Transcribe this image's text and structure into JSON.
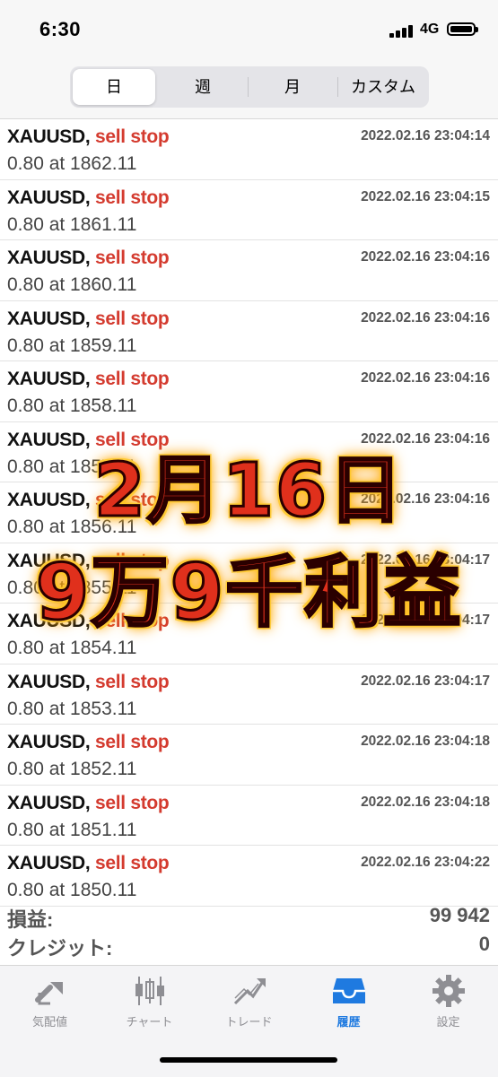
{
  "status_bar": {
    "time": "6:30",
    "network": "4G"
  },
  "segments": {
    "items": [
      "日",
      "週",
      "月",
      "カスタム"
    ],
    "selected": "日"
  },
  "orders": [
    {
      "symbol": "XAUUSD,",
      "type": "sell stop",
      "time": "2022.02.16 23:04:14",
      "volume_price": "0.80 at 1862.11"
    },
    {
      "symbol": "XAUUSD,",
      "type": "sell stop",
      "time": "2022.02.16 23:04:15",
      "volume_price": "0.80 at 1861.11"
    },
    {
      "symbol": "XAUUSD,",
      "type": "sell stop",
      "time": "2022.02.16 23:04:16",
      "volume_price": "0.80 at 1860.11"
    },
    {
      "symbol": "XAUUSD,",
      "type": "sell stop",
      "time": "2022.02.16 23:04:16",
      "volume_price": "0.80 at 1859.11"
    },
    {
      "symbol": "XAUUSD,",
      "type": "sell stop",
      "time": "2022.02.16 23:04:16",
      "volume_price": "0.80 at 1858.11"
    },
    {
      "symbol": "XAUUSD,",
      "type": "sell stop",
      "time": "2022.02.16 23:04:16",
      "volume_price": "0.80 at 1857.11"
    },
    {
      "symbol": "XAUUSD,",
      "type": "sell stop",
      "time": "2022.02.16 23:04:16",
      "volume_price": "0.80 at 1856.11"
    },
    {
      "symbol": "XAUUSD,",
      "type": "sell stop",
      "time": "2022.02.16 23:04:17",
      "volume_price": "0.80 at 1855.11"
    },
    {
      "symbol": "XAUUSD,",
      "type": "sell stop",
      "time": "2022.02.16 23:04:17",
      "volume_price": "0.80 at 1854.11"
    },
    {
      "symbol": "XAUUSD,",
      "type": "sell stop",
      "time": "2022.02.16 23:04:17",
      "volume_price": "0.80 at 1853.11"
    },
    {
      "symbol": "XAUUSD,",
      "type": "sell stop",
      "time": "2022.02.16 23:04:18",
      "volume_price": "0.80 at 1852.11"
    },
    {
      "symbol": "XAUUSD,",
      "type": "sell stop",
      "time": "2022.02.16 23:04:18",
      "volume_price": "0.80 at 1851.11"
    },
    {
      "symbol": "XAUUSD,",
      "type": "sell stop",
      "time": "2022.02.16 23:04:22",
      "volume_price": "0.80 at 1850.11"
    }
  ],
  "summary": {
    "profit_label": "損益:",
    "profit_value": "99 942",
    "credit_label": "クレジット:",
    "credit_value": "0"
  },
  "overlay": {
    "line1": "2月16日",
    "line2": "9万9千利益"
  },
  "tabbar": {
    "items": [
      {
        "label": "気配値",
        "icon": "quotes-icon"
      },
      {
        "label": "チャート",
        "icon": "chart-icon"
      },
      {
        "label": "トレード",
        "icon": "trade-icon"
      },
      {
        "label": "履歴",
        "icon": "history-icon"
      },
      {
        "label": "設定",
        "icon": "settings-icon"
      }
    ],
    "selected": "履歴"
  },
  "colors": {
    "sell_stop": "#d43b2f",
    "active_tab": "#1f7ae0",
    "inactive_tab": "#8e8e93",
    "overlay_text": "#e0301c",
    "overlay_glow": "#ffcf3a"
  }
}
